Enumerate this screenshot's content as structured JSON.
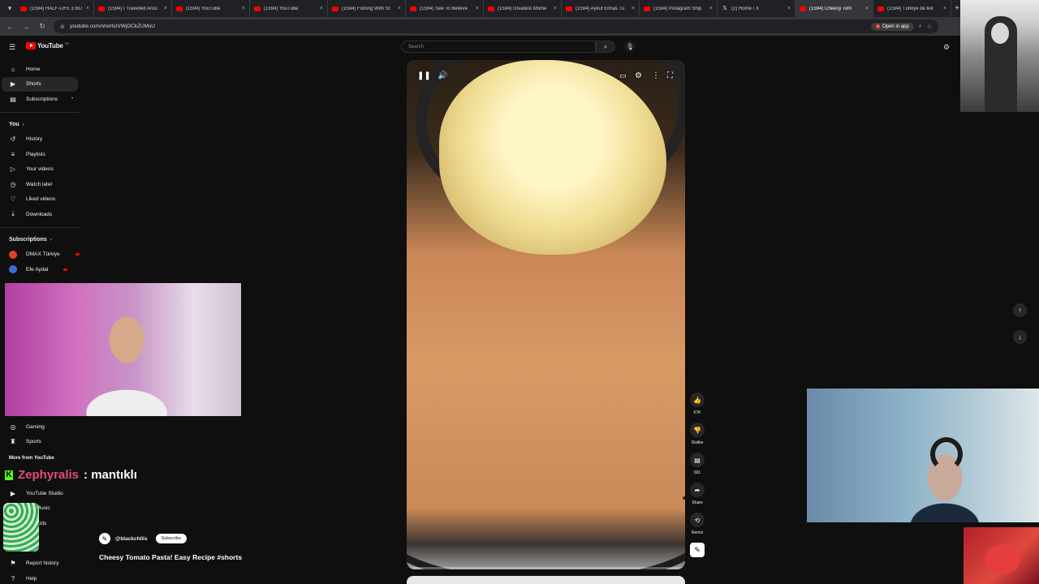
{
  "browser": {
    "tabs": [
      {
        "title": "(1594) HALF-LIFE 3 BU",
        "icon": "youtube-icon",
        "active": false
      },
      {
        "title": "(1594) I Travelled Arou",
        "icon": "youtube-icon",
        "active": false
      },
      {
        "title": "(1594) YouTube",
        "icon": "youtube-icon",
        "active": false
      },
      {
        "title": "(1594) YouTube",
        "icon": "youtube-icon",
        "active": false
      },
      {
        "title": "(1594) Fishing With St",
        "icon": "youtube-icon",
        "active": false
      },
      {
        "title": "(1594) See To Believe",
        "icon": "youtube-icon",
        "active": false
      },
      {
        "title": "(1594) Greatest Mome",
        "icon": "youtube-icon",
        "active": false
      },
      {
        "title": "(1594) Aykut Elmas Tü",
        "icon": "youtube-icon",
        "active": false
      },
      {
        "title": "(1594) Instagram Ship",
        "icon": "youtube-icon",
        "active": false
      },
      {
        "title": "(2) Home / X",
        "icon": "x-icon",
        "active": false
      },
      {
        "title": "(1594) Cheesy Tom",
        "icon": "youtube-icon",
        "active": true
      },
      {
        "title": "(1594) Türkiye de tek",
        "icon": "youtube-icon",
        "active": false
      }
    ],
    "url": "youtube.com/shorts/VWjDCkZUMsU",
    "open_in_app": "Open in app"
  },
  "header": {
    "logo_text": "YouTube",
    "country_code": "TR",
    "search_placeholder": "Search"
  },
  "sidebar": {
    "main": [
      {
        "label": "Home",
        "icon": "home-icon"
      },
      {
        "label": "Shorts",
        "icon": "shorts-icon",
        "active": true
      },
      {
        "label": "Subscriptions",
        "icon": "subscriptions-icon"
      }
    ],
    "you_label": "You",
    "you_items": [
      {
        "label": "History",
        "icon": "history-icon"
      },
      {
        "label": "Playlists",
        "icon": "playlists-icon"
      },
      {
        "label": "Your videos",
        "icon": "your-videos-icon"
      },
      {
        "label": "Watch later",
        "icon": "watch-later-icon"
      },
      {
        "label": "Liked videos",
        "icon": "liked-videos-icon"
      },
      {
        "label": "Downloads",
        "icon": "downloads-icon"
      }
    ],
    "subscriptions_label": "Subscriptions",
    "subscriptions": [
      {
        "label": "DMAX Türkiye",
        "color": "#e2401c"
      },
      {
        "label": "Efe Aydal",
        "color": "#3a6fd8"
      }
    ],
    "explore": [
      {
        "label": "Gaming",
        "icon": "gaming-icon"
      },
      {
        "label": "Sports",
        "icon": "sports-icon"
      }
    ],
    "more_label": "More from YouTube",
    "more": [
      {
        "label": "YouTube Studio",
        "icon": "studio-icon"
      },
      {
        "label": "ube Music",
        "icon": "music-icon"
      },
      {
        "label": "ube Kids",
        "icon": "kids-icon"
      }
    ],
    "footer": [
      {
        "label": "ttings",
        "icon": "settings-icon"
      },
      {
        "label": "Report history",
        "icon": "flag-icon"
      },
      {
        "label": "Help",
        "icon": "help-icon"
      }
    ]
  },
  "chat": {
    "platform_badge": "K",
    "user": "Zephyralis",
    "message": ": mantıklı"
  },
  "short": {
    "channel_handle": "@blackchilis",
    "subscribe_label": "Subscribe",
    "title": "Cheesy Tomato Pasta! Easy Recipe #shorts",
    "progress": 0.0
  },
  "actions": [
    {
      "label": "57K",
      "icon": "like-icon"
    },
    {
      "label": "Dislike",
      "icon": "dislike-icon"
    },
    {
      "label": "691",
      "icon": "comment-icon"
    },
    {
      "label": "Share",
      "icon": "share-icon"
    },
    {
      "label": "Remix",
      "icon": "remix-icon"
    }
  ],
  "colors": {
    "background": "#0f0f0f",
    "brand_red": "#ff0000",
    "chat_user": "#e84b7a",
    "kick_green": "#53fc18"
  }
}
